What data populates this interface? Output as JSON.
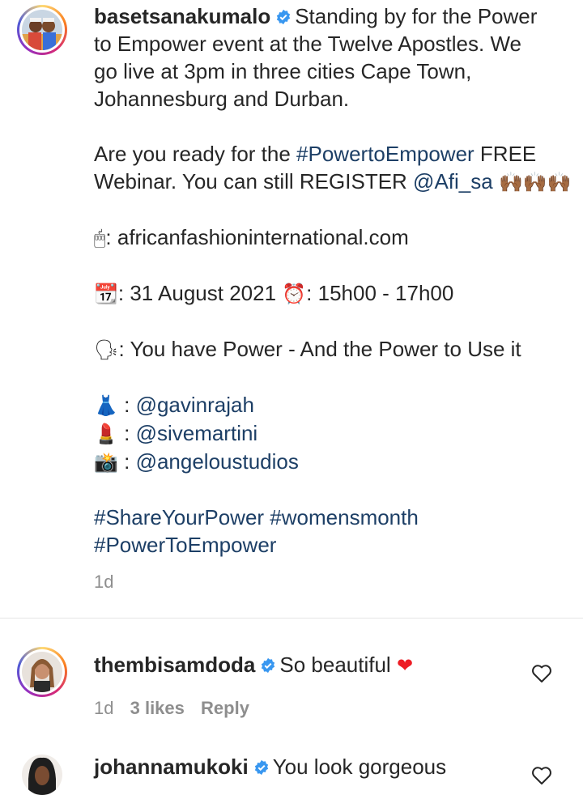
{
  "post": {
    "username": "basetsanakumalo",
    "caption_lines": [
      "Standing by for the Power",
      "to Empower event at the Twelve Apostles. We",
      "go live at 3pm in three cities Cape Town,",
      "Johannesburg and Durban."
    ],
    "ready_text_1": "Are you ready for the ",
    "hashtag_power": "#PowertoEmpower",
    "ready_text_2": " FREE",
    "register_text": "Webinar. You can still REGISTER ",
    "mention_afi": "@Afi_sa",
    "raised_hands": "🙌🏾🙌🏾🙌🏾",
    "mouse_emoji": "🖱",
    "website": ": africanfashioninternational.com",
    "calendar_emoji": "📆",
    "date_text": ": 31 August 2021 ",
    "clock_emoji": "⏰",
    "time_text": ": 15h00 - 17h00",
    "speaking_emoji": "🗣",
    "theme_text": ": You have Power - And the Power to Use it",
    "credits": [
      {
        "emoji": "👗",
        "sep": " : ",
        "handle": "@gavinrajah"
      },
      {
        "emoji": "💄",
        "sep": " : ",
        "handle": "@sivemartini"
      },
      {
        "emoji": "📸",
        "sep": " : ",
        "handle": "@angeloustudios"
      }
    ],
    "hashtags_line1": "#ShareYourPower #womensmonth",
    "hashtags_line2": "#PowerToEmpower",
    "time": "1d"
  },
  "comments": [
    {
      "username": "thembisamdoda",
      "text": "So beautiful",
      "emoji": "❤",
      "time": "1d",
      "likes": "3 likes",
      "reply": "Reply"
    },
    {
      "username": "johannamukoki",
      "text": "You look gorgeous"
    }
  ],
  "colors": {
    "link": "#1d3f66",
    "muted": "#8e8e8e",
    "verified": "#3897f0",
    "heart": "#ed1c24"
  }
}
